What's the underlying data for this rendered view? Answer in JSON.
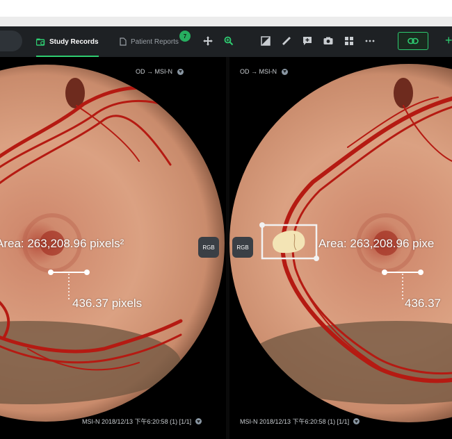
{
  "toolbar": {
    "tabs": [
      {
        "label": "Study Records",
        "active": true
      },
      {
        "label": "Patient Reports",
        "badge": "7"
      }
    ],
    "tools": [
      "move-icon",
      "zoom-icon",
      "contrast-icon",
      "ruler-icon",
      "annotate-icon",
      "camera-icon",
      "layout-icon",
      "more-icon"
    ],
    "link_icon": "link-icon",
    "accent": "#2ecc71"
  },
  "viewports": [
    {
      "header": "OD → MSI-N",
      "footer": "MSI-N 2018/12/13 下午6:20:58 (1) [1/1]",
      "rgb_label": "RGB",
      "area_text": "Area: 263,208.96 pixels²",
      "length_text": "436.37 pixels"
    },
    {
      "header": "OD → MSI-N",
      "footer": "MSI-N 2018/12/13 下午6:20:58 (1) [1/1]",
      "rgb_label": "RGB",
      "area_text": "Area: 263,208.96 pixe",
      "length_text": "436.37"
    }
  ],
  "colors": {
    "fundus_base": "#c98a6e",
    "vessel": "#b51a12",
    "toolbar_bg": "#1e2124"
  }
}
